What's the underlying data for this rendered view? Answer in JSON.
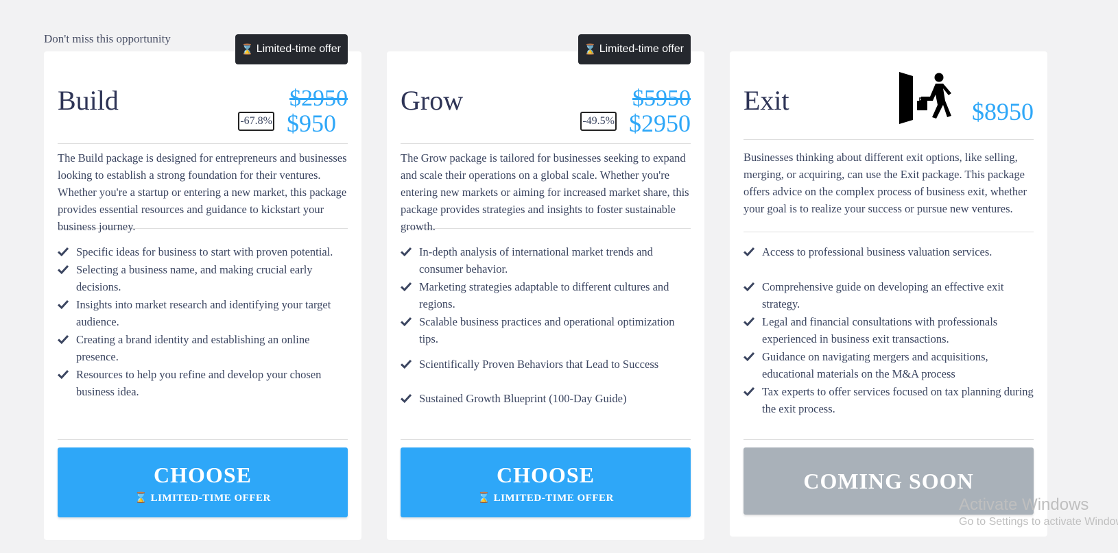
{
  "eyebrow": "Don't miss this opportunity",
  "colors": {
    "accent": "#2ea7f8",
    "disabled": "#a9b1b9",
    "badge_bg": "#25282e",
    "title": "#2e3456"
  },
  "plans": [
    {
      "badge": "Limited-time offer",
      "title": "Build",
      "old_price": "$2950",
      "price": "$950",
      "discount": "-67.8%",
      "description": "The Build package is designed for entrepreneurs and businesses looking to establish a strong foundation for their ventures. Whether you're a startup or entering a new market, this package provides essential resources and guidance to kickstart your business journey.",
      "features": [
        "Specific ideas for business to start with proven potential.",
        "Selecting a business name, and making crucial early decisions.",
        "Insights into market research and identifying your target audience.",
        "Creating a brand identity and establishing an online presence.",
        "Resources to help you refine and develop your chosen business idea."
      ],
      "cta_label": "CHOOSE",
      "cta_sub": "LIMITED-TIME OFFER"
    },
    {
      "badge": "Limited-time offer",
      "title": "Grow",
      "old_price": "$5950",
      "price": "$2950",
      "discount": "-49.5%",
      "description": "The Grow package is tailored for businesses seeking to expand and scale their operations on a global scale. Whether you're entering new markets or aiming for increased market share, this package provides strategies and insights to foster sustainable growth.",
      "features": [
        "In-depth analysis of international market trends and consumer behavior.",
        "Marketing strategies adaptable to different cultures and regions.",
        "Scalable business practices and operational optimization tips.",
        "Scientifically Proven Behaviors that Lead to Success",
        "Sustained Growth Blueprint (100-Day Guide)"
      ],
      "cta_label": "CHOOSE",
      "cta_sub": "LIMITED-TIME OFFER"
    },
    {
      "title": "Exit",
      "price": "$8950",
      "icon": "exit-door-icon",
      "description": "Businesses thinking about different exit options, like selling, merging, or acquiring, can use the Exit package. This package offers advice on the complex process of business exit, whether your goal is to realize your success or pursue new ventures.",
      "features": [
        "Access to professional business valuation services.",
        "Comprehensive guide on developing an effective exit strategy.",
        "Legal and financial consultations with professionals experienced in business exit transactions.",
        "Guidance on navigating mergers and acquisitions, educational materials on the M&A process",
        "Tax experts to offer services focused on tax planning during the exit process."
      ],
      "cta_label": "COMING SOON"
    }
  ],
  "watermark": {
    "line1": "Activate Windows",
    "line2": "Go to Settings to activate Windows."
  }
}
